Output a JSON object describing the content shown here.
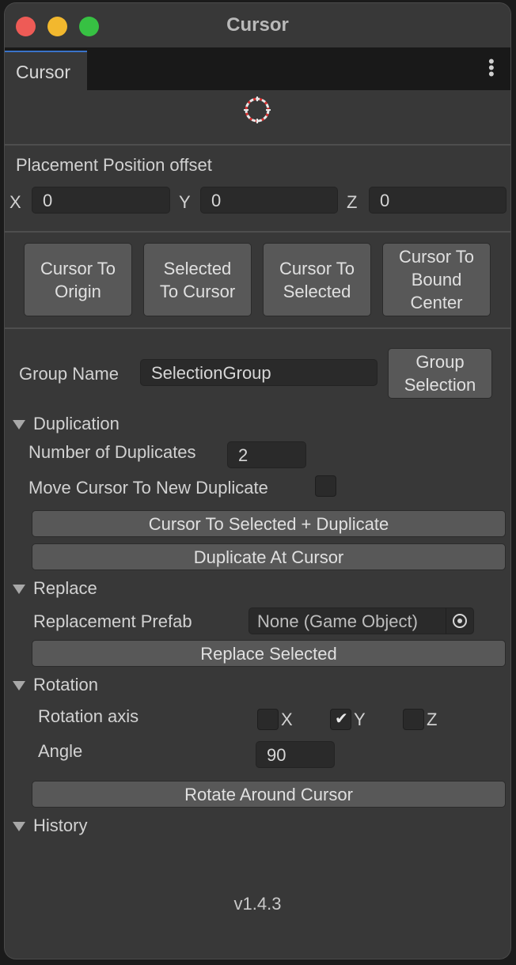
{
  "window": {
    "title": "Cursor"
  },
  "tab": {
    "label": "Cursor"
  },
  "placement": {
    "heading": "Placement Position offset",
    "x_label": "X",
    "x_value": "0",
    "y_label": "Y",
    "y_value": "0",
    "z_label": "Z",
    "z_value": "0"
  },
  "actions": {
    "cursor_to_origin": [
      "Cursor To",
      "Origin"
    ],
    "selected_to_cursor": [
      "Selected",
      "To Cursor"
    ],
    "cursor_to_selected": [
      "Cursor To",
      "Selected"
    ],
    "cursor_to_bound_center": [
      "Cursor To",
      "Bound",
      "Center"
    ]
  },
  "group": {
    "label": "Group Name",
    "value": "SelectionGroup",
    "button": [
      "Group",
      "Selection"
    ]
  },
  "duplication": {
    "heading": "Duplication",
    "count_label": "Number of Duplicates",
    "count_value": "2",
    "move_label": "Move Cursor To New Duplicate",
    "move_checked": false,
    "btn_cursor_selected_dup": "Cursor To Selected + Duplicate",
    "btn_dup_at_cursor": "Duplicate At Cursor"
  },
  "replace": {
    "heading": "Replace",
    "prefab_label": "Replacement Prefab",
    "prefab_value": "None (Game Object)",
    "btn_replace": "Replace Selected"
  },
  "rotation": {
    "heading": "Rotation",
    "axis_label": "Rotation axis",
    "axes": [
      {
        "label": "X",
        "checked": false
      },
      {
        "label": "Y",
        "checked": true
      },
      {
        "label": "Z",
        "checked": false
      }
    ],
    "angle_label": "Angle",
    "angle_value": "90",
    "btn_rotate": "Rotate Around Cursor"
  },
  "history": {
    "heading": "History"
  },
  "footer": {
    "version": "v1.4.3"
  },
  "colors": {
    "accent": "#3a73c9",
    "background": "#383838",
    "button": "#585858"
  },
  "icons": {
    "menu": "kebab-menu-icon",
    "cursor": "crosshair-icon",
    "picker": "object-picker-icon",
    "foldout": "triangle-down-icon"
  }
}
